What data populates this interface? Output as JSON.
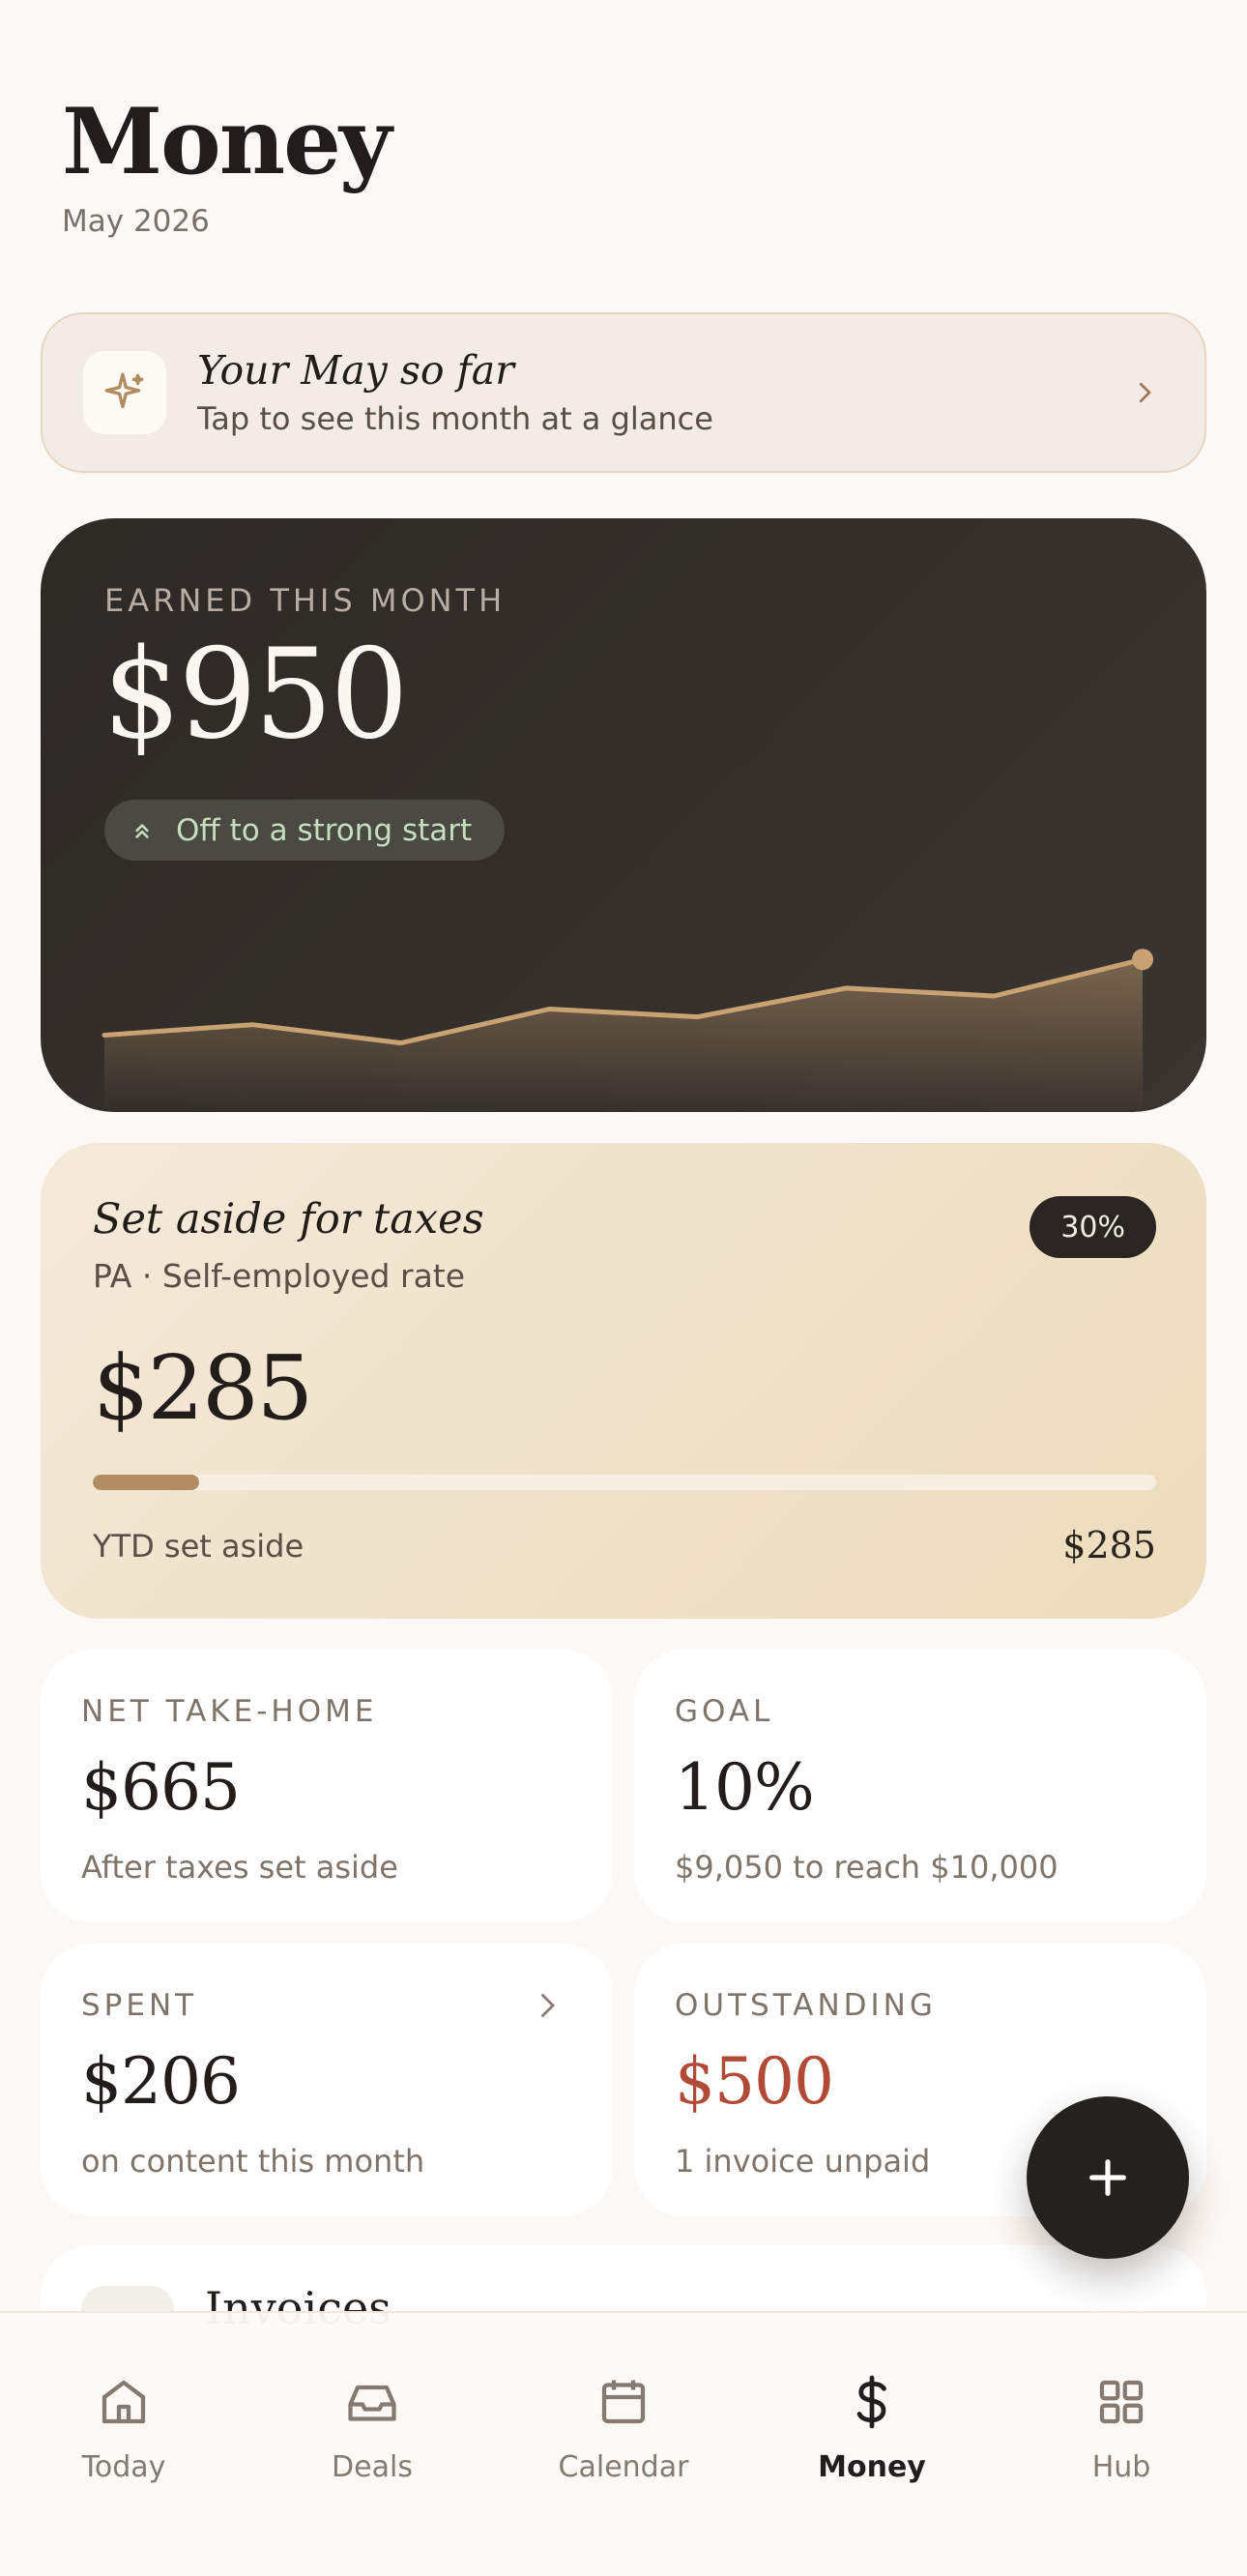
{
  "header": {
    "title": "Money",
    "subtitle": "May 2026"
  },
  "recap": {
    "title": "Your May so far",
    "subtitle": "Tap to see this month at a glance",
    "icon": "sparkle-icon"
  },
  "earned": {
    "label": "EARNED THIS MONTH",
    "amount": "$950",
    "pill": "Off to a strong start",
    "trend": [
      0.3,
      0.38,
      0.24,
      0.5,
      0.44,
      0.66,
      0.6,
      0.88
    ]
  },
  "taxes": {
    "title": "Set aside for taxes",
    "subtitle": "PA · Self-employed rate",
    "rate_badge": "30%",
    "amount": "$285",
    "progress_fraction": 0.1,
    "footer_label": "YTD set aside",
    "footer_value": "$285"
  },
  "stats": {
    "net": {
      "label": "NET TAKE-HOME",
      "value": "$665",
      "note": "After taxes set aside"
    },
    "goal": {
      "label": "GOAL",
      "value": "10%",
      "note": "$9,050 to reach $10,000"
    },
    "spent": {
      "label": "SPENT",
      "value": "$206",
      "note": "on content this month"
    },
    "outstanding": {
      "label": "OUTSTANDING",
      "value": "$500",
      "note": "1 invoice unpaid"
    }
  },
  "invoices": {
    "title": "Invoices"
  },
  "tabs": [
    {
      "label": "Today",
      "icon": "home-icon"
    },
    {
      "label": "Deals",
      "icon": "inbox-icon"
    },
    {
      "label": "Calendar",
      "icon": "calendar-icon"
    },
    {
      "label": "Money",
      "icon": "dollar-icon"
    },
    {
      "label": "Hub",
      "icon": "grid-icon"
    }
  ],
  "colors": {
    "accent_gold": "#b18d61",
    "dark_card": "#2d2926",
    "outstanding_red": "#b24a38",
    "positive_green": "#c8ddc0"
  }
}
